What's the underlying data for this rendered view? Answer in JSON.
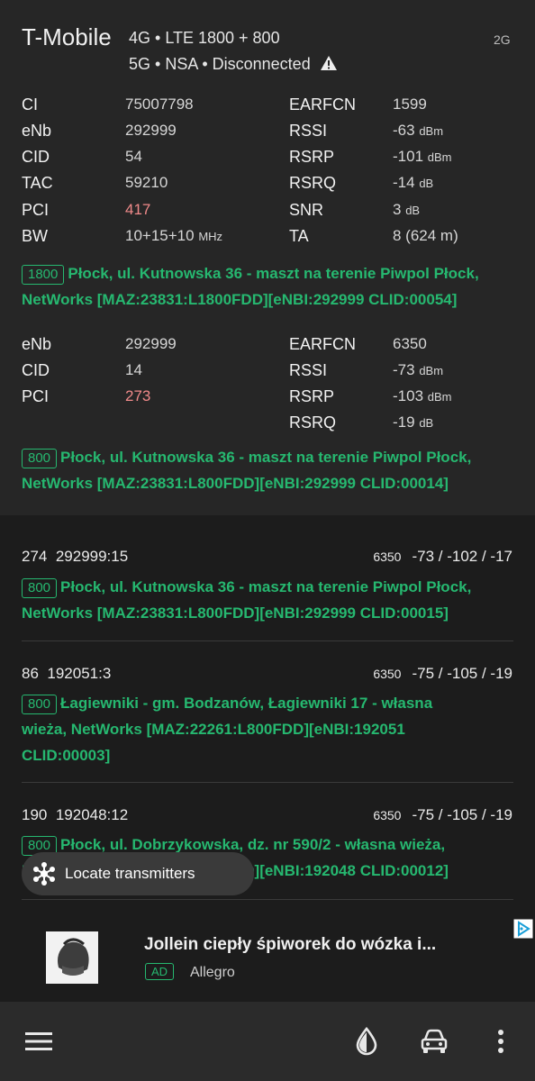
{
  "header": {
    "operator": "T-Mobile",
    "network_line1": "4G • LTE 1800 + 800",
    "network_line2": "5G • NSA • Disconnected",
    "tag": "2G"
  },
  "cell1": {
    "left": [
      {
        "label": "CI",
        "value": "75007798"
      },
      {
        "label": "eNb",
        "value": "292999"
      },
      {
        "label": "CID",
        "value": "54"
      },
      {
        "label": "TAC",
        "value": "59210"
      },
      {
        "label": "PCI",
        "value": "417"
      },
      {
        "label": "BW",
        "value": "10+15+10",
        "unit": "MHz"
      }
    ],
    "right": [
      {
        "label": "EARFCN",
        "value": "1599",
        "unit": ""
      },
      {
        "label": "RSSI",
        "value": "-63",
        "unit": "dBm"
      },
      {
        "label": "RSRP",
        "value": "-101",
        "unit": "dBm"
      },
      {
        "label": "RSRQ",
        "value": "-14",
        "unit": "dB"
      },
      {
        "label": "SNR",
        "value": "3",
        "unit": "dB"
      },
      {
        "label": "TA",
        "value": "8 (624 m)",
        "unit": ""
      }
    ],
    "band": "1800",
    "location_line1": "Płock, ul. Kutnowska 36 - maszt na terenie Piwpol Płock,",
    "location_line2": "NetWorks [MAZ:23831:L1800FDD][eNBI:292999 CLID:00054]"
  },
  "cell2": {
    "left": [
      {
        "label": "eNb",
        "value": "292999"
      },
      {
        "label": "CID",
        "value": "14"
      },
      {
        "label": "PCI",
        "value": "273"
      }
    ],
    "right": [
      {
        "label": "EARFCN",
        "value": "6350",
        "unit": ""
      },
      {
        "label": "RSSI",
        "value": "-73",
        "unit": "dBm"
      },
      {
        "label": "RSRP",
        "value": "-103",
        "unit": "dBm"
      },
      {
        "label": "RSRQ",
        "value": "-19",
        "unit": "dB"
      }
    ],
    "band": "800",
    "location_line1": "Płock, ul. Kutnowska 36 - maszt na terenie Piwpol Płock,",
    "location_line2": "NetWorks [MAZ:23831:L800FDD][eNBI:292999 CLID:00014]"
  },
  "neighbors": [
    {
      "pci": "274",
      "id": "292999:15",
      "earfcn": "6350",
      "signal": "-73 / -102 / -17",
      "band": "800",
      "lines": [
        "Płock, ul. Kutnowska 36 - maszt na terenie Piwpol Płock,",
        "NetWorks [MAZ:23831:L800FDD][eNBI:292999 CLID:00015]"
      ]
    },
    {
      "pci": "86",
      "id": "192051:3",
      "earfcn": "6350",
      "signal": "-75 / -105 / -19",
      "band": "800",
      "lines": [
        "Łagiewniki - gm. Bodzanów, Łagiewniki 17 - własna",
        "wieża, NetWorks [MAZ:22261:L800FDD][eNBI:192051",
        "CLID:00003]"
      ]
    },
    {
      "pci": "190",
      "id": "192048:12",
      "earfcn": "6350",
      "signal": "-75 / -105 / -19",
      "band": "800",
      "lines": [
        "Płock, ul. Dobrzykowska, dz. nr 590/2 - własna wieża,",
        "NetWorks [MAZ:22261:L800FDD][eNBI:192048 CLID:00012]"
      ]
    }
  ],
  "fab": {
    "label": "Locate transmitters"
  },
  "ad": {
    "title": "Jollein ciepły śpiworek do wózka i...",
    "badge": "AD",
    "source": "Allegro"
  },
  "colors": {
    "accent": "#26b870",
    "pci_highlight": "#f08a8a",
    "background": "#1c1c1c",
    "panel": "#262626"
  },
  "bottom_bar": {
    "icons": [
      "menu-icon",
      "drop-icon",
      "car-icon",
      "more-vert-icon"
    ]
  }
}
